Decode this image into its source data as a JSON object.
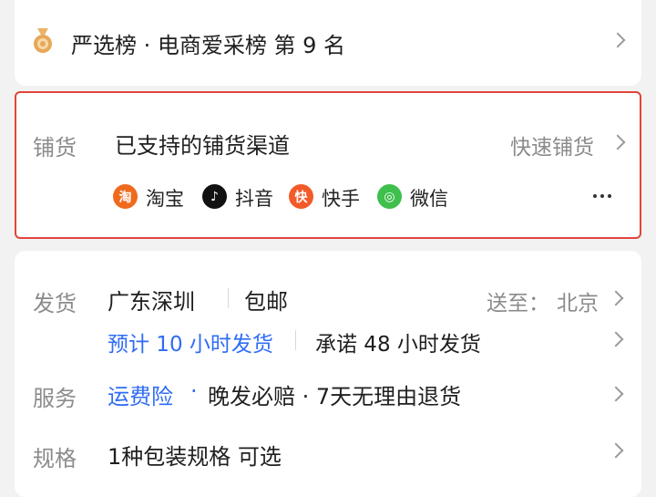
{
  "rank": {
    "text": "严选榜 · 电商爱采榜 第 9 名"
  },
  "distribution": {
    "label": "铺货",
    "title": "已支持的铺货渠道",
    "action": "快速铺货",
    "platforms": [
      {
        "name": "淘宝",
        "icon": "taobao-icon",
        "icon_text": "淘",
        "color": "#f06a1d"
      },
      {
        "name": "抖音",
        "icon": "douyin-icon",
        "icon_text": "♪",
        "color": "#111111"
      },
      {
        "name": "快手",
        "icon": "kuaishou-icon",
        "icon_text": "快",
        "color": "#f35a2a"
      },
      {
        "name": "微信",
        "icon": "wechat-icon",
        "icon_text": "◎",
        "color": "#3fbf4c"
      }
    ],
    "more": "more-icon"
  },
  "shipping": {
    "label": "发货",
    "origin": "广东深圳",
    "free_shipping": "包邮",
    "ship_to_label": "送至：",
    "ship_to_city": "北京",
    "estimate": "预计 10 小时发货",
    "promise": "承诺 48 小时发货"
  },
  "service": {
    "label": "服务",
    "insurance": "运费险",
    "dot": "·",
    "rest": "晚发必赔 · 7天无理由退货"
  },
  "spec": {
    "label": "规格",
    "text": "1种包装规格 可选"
  },
  "colors": {
    "accent_blue": "#2f6cf6",
    "highlight_border": "#e2443b"
  }
}
